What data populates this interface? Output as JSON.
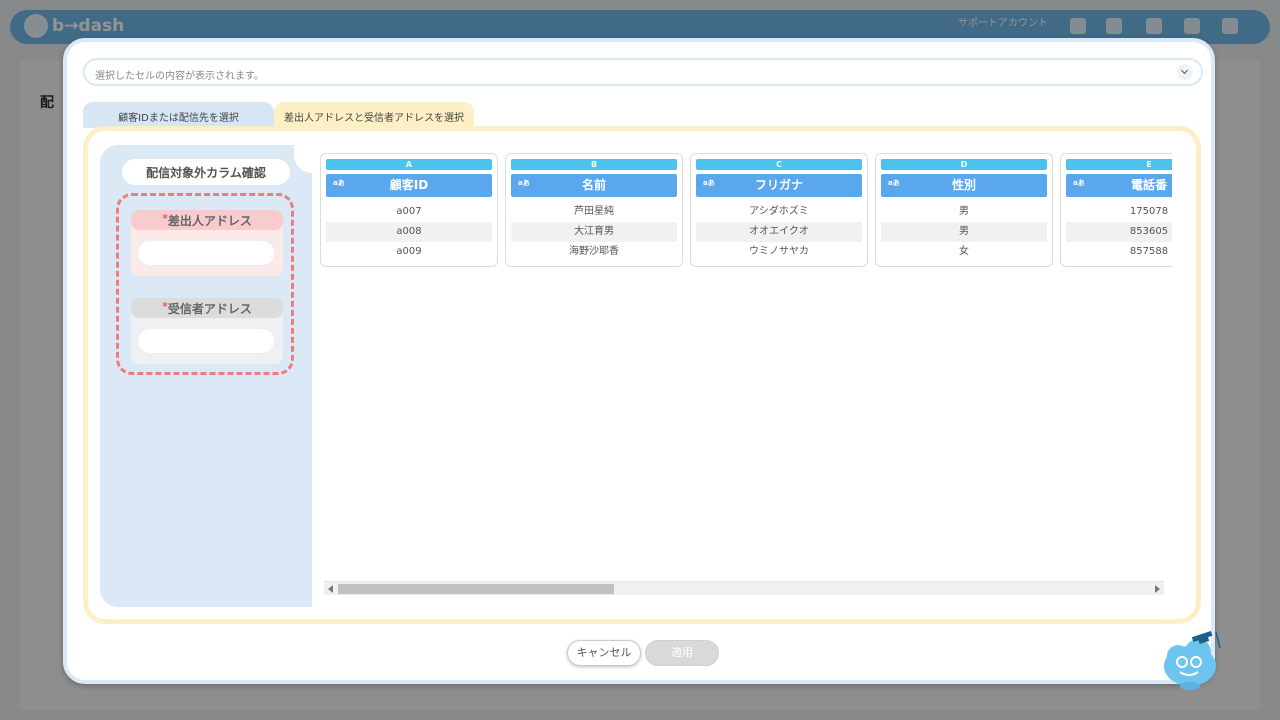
{
  "app": {
    "logo": "b→dash",
    "account": "サポートアカウント",
    "background_heading": "配"
  },
  "selected_cell": {
    "text": "選択したセルの内容が表示されます。"
  },
  "tabs": [
    {
      "label": "顧客IDまたは配信先を選択"
    },
    {
      "label": "差出人アドレスと受信者アドレスを選択"
    }
  ],
  "side": {
    "title": "配信対象外カラム確認",
    "required_mark": "*",
    "sender_label": "差出人アドレス",
    "receiver_label": "受信者アドレス"
  },
  "columns": [
    {
      "letter": "A",
      "type": "aあ",
      "name": "顧客ID",
      "values": [
        "a007",
        "a008",
        "a009"
      ]
    },
    {
      "letter": "B",
      "type": "aあ",
      "name": "名前",
      "values": [
        "芦田星純",
        "大江育男",
        "海野沙耶香"
      ]
    },
    {
      "letter": "C",
      "type": "aあ",
      "name": "フリガナ",
      "values": [
        "アシダホズミ",
        "オオエイクオ",
        "ウミノサヤカ"
      ]
    },
    {
      "letter": "D",
      "type": "aあ",
      "name": "性別",
      "values": [
        "男",
        "男",
        "女"
      ]
    },
    {
      "letter": "E",
      "type": "aあ",
      "name": "電話番",
      "values": [
        "175078",
        "853605",
        "857588"
      ]
    }
  ],
  "scroll": {
    "thumb_fraction": 0.34
  },
  "buttons": {
    "cancel": "キャンセル",
    "apply": "適用"
  },
  "colors": {
    "accent_blue": "#5aa7ee",
    "letter_blue": "#4cc3ee",
    "tab_yellow": "#fdefc5",
    "sender_pink": "#f9cbcd",
    "dash_red": "#f07a80"
  }
}
